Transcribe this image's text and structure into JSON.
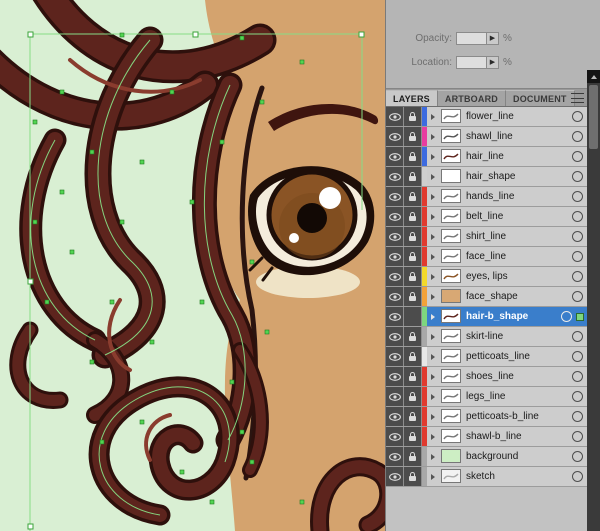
{
  "gradient_panel": {
    "opacity_label": "Opacity:",
    "location_label": "Location:",
    "percent": "%"
  },
  "tabs": {
    "items": [
      {
        "label": "LAYERS",
        "active": true
      },
      {
        "label": "ARTBOARD",
        "active": false
      },
      {
        "label": "DOCUMENT",
        "active": false
      }
    ]
  },
  "layers": [
    {
      "name": "flower_line",
      "color": "#3d6be0",
      "thumb_fill": "#ffffff",
      "thumb_mark": "#777777",
      "locked": true,
      "selected": false
    },
    {
      "name": "shawl_line",
      "color": "#e83da0",
      "thumb_fill": "#ffffff",
      "thumb_mark": "#555555",
      "locked": true,
      "selected": false
    },
    {
      "name": "hair_line",
      "color": "#3d6be0",
      "thumb_fill": "#ffffff",
      "thumb_mark": "#5d241d",
      "locked": true,
      "selected": false
    },
    {
      "name": "hair_shape",
      "color": "#cfcfcf",
      "thumb_fill": "#ffffff",
      "thumb_mark": null,
      "locked": true,
      "selected": false
    },
    {
      "name": "hands_line",
      "color": "#e03a2f",
      "thumb_fill": "#ffffff",
      "thumb_mark": "#777777",
      "locked": true,
      "selected": false
    },
    {
      "name": "belt_line",
      "color": "#e03a2f",
      "thumb_fill": "#ffffff",
      "thumb_mark": "#777777",
      "locked": true,
      "selected": false
    },
    {
      "name": "shirt_line",
      "color": "#e03a2f",
      "thumb_fill": "#ffffff",
      "thumb_mark": "#777777",
      "locked": true,
      "selected": false
    },
    {
      "name": "face_line",
      "color": "#e03a2f",
      "thumb_fill": "#ffffff",
      "thumb_mark": "#777777",
      "locked": true,
      "selected": false
    },
    {
      "name": "eyes, lips",
      "color": "#f2d92a",
      "thumb_fill": "#ffffff",
      "thumb_mark": "#8a5425",
      "locked": true,
      "selected": false
    },
    {
      "name": "face_shape",
      "color": "#f2a23a",
      "thumb_fill": "#d8a874",
      "thumb_mark": null,
      "locked": true,
      "selected": false
    },
    {
      "name": "hair-b_shape",
      "color": "#7ed67e",
      "thumb_fill": "#ffffff",
      "thumb_mark": "#5d241d",
      "locked": false,
      "selected": true
    },
    {
      "name": "skirt-line",
      "color": "#a8a8a8",
      "thumb_fill": "#ffffff",
      "thumb_mark": "#777777",
      "locked": true,
      "selected": false
    },
    {
      "name": "petticoats_line",
      "color": "#e8e8e8",
      "thumb_fill": "#ffffff",
      "thumb_mark": "#777777",
      "locked": true,
      "selected": false
    },
    {
      "name": "shoes_line",
      "color": "#e03a2f",
      "thumb_fill": "#ffffff",
      "thumb_mark": "#777777",
      "locked": true,
      "selected": false
    },
    {
      "name": "legs_line",
      "color": "#e03a2f",
      "thumb_fill": "#ffffff",
      "thumb_mark": "#777777",
      "locked": true,
      "selected": false
    },
    {
      "name": "petticoats-b_line",
      "color": "#e03a2f",
      "thumb_fill": "#ffffff",
      "thumb_mark": "#777777",
      "locked": true,
      "selected": false
    },
    {
      "name": "shawl-b_line",
      "color": "#e03a2f",
      "thumb_fill": "#ffffff",
      "thumb_mark": "#777777",
      "locked": true,
      "selected": false
    },
    {
      "name": "background",
      "color": "#a8a8a8",
      "thumb_fill": "#cdeec4",
      "thumb_mark": null,
      "locked": true,
      "selected": false
    },
    {
      "name": "sketch",
      "color": "#a8a8a8",
      "thumb_fill": "#f2f2f2",
      "thumb_mark": "#aaaaaa",
      "locked": true,
      "selected": false
    }
  ],
  "colors": {
    "selection_blue": "#3a7ecb",
    "canvas_bg": "#d9efd3",
    "hair": "#5d241d",
    "hair_outline": "#2e100c",
    "skin": "#d4a36e",
    "anchor_green": "#52d452"
  }
}
